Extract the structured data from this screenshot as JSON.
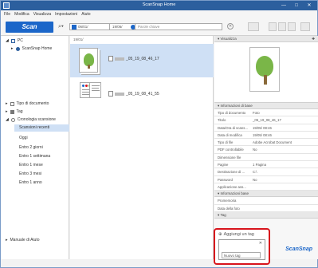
{
  "window": {
    "title": "ScanSnap Home",
    "controls": [
      "—",
      "□",
      "✕"
    ]
  },
  "menu": [
    "File",
    "Modifica",
    "Visualizza",
    "Impostazioni",
    "Aiuto"
  ],
  "toolbar": {
    "scan_label": "Scan",
    "date_from": "06/01/",
    "date_to": "19/06/",
    "keyword_placeholder": "Parole chiave"
  },
  "sidebar": {
    "pc_label": "PC",
    "home_label": "ScanSnap Home",
    "doc_type_label": "Tipo di documento",
    "tag_label": "Tag",
    "history_label": "Cronologia scansione",
    "history_items": [
      "Scansioni recenti",
      "Oggi",
      "Entro 2 giorni",
      "Entro 1 settimana",
      "Entro 1 mese",
      "Entro 3 mesi",
      "Entro 1 anno"
    ],
    "manual_label": "Manuale di Aiuto"
  },
  "file_list": {
    "header": "19/01/",
    "files": [
      {
        "name": "_05_19_08_46_17"
      },
      {
        "name": "_05_19_08_41_55"
      }
    ]
  },
  "preview": {
    "header": "Visualizza"
  },
  "basic_info": {
    "header": "Informazioni di base",
    "rows": [
      {
        "k": "Tipo di documento",
        "v": "Foto"
      },
      {
        "k": "Titolo",
        "v": "_05_19_08_46_17"
      },
      {
        "k": "Data/Ora di scans...",
        "v": "19/05/       08:46"
      },
      {
        "k": "Data di modifica",
        "v": "19/05/       08:46"
      },
      {
        "k": "Tipo di file",
        "v": "Adobe Acrobat Document"
      },
      {
        "k": "PDF controllabile",
        "v": "No"
      },
      {
        "k": "Dimensione file",
        "v": ""
      },
      {
        "k": "Pagine",
        "v": "1 Pagina"
      },
      {
        "k": "Destinazione di ...",
        "v": "C:\\"
      },
      {
        "k": "Password",
        "v": "No"
      },
      {
        "k": "Applicazione ass...",
        "v": ""
      }
    ]
  },
  "base_info": {
    "header": "Informazioni base",
    "rows": [
      {
        "k": "Promemoria",
        "v": ""
      },
      {
        "k": "Data della foto",
        "v": ""
      }
    ]
  },
  "tag_section": {
    "header": "Tag",
    "add_label": "Aggiungi un tag",
    "input_value": "Nuovo tag"
  },
  "brand": {
    "logo_text": "ScanSnap",
    "accent": "#1b66c9",
    "highlight": "#d8141c"
  }
}
